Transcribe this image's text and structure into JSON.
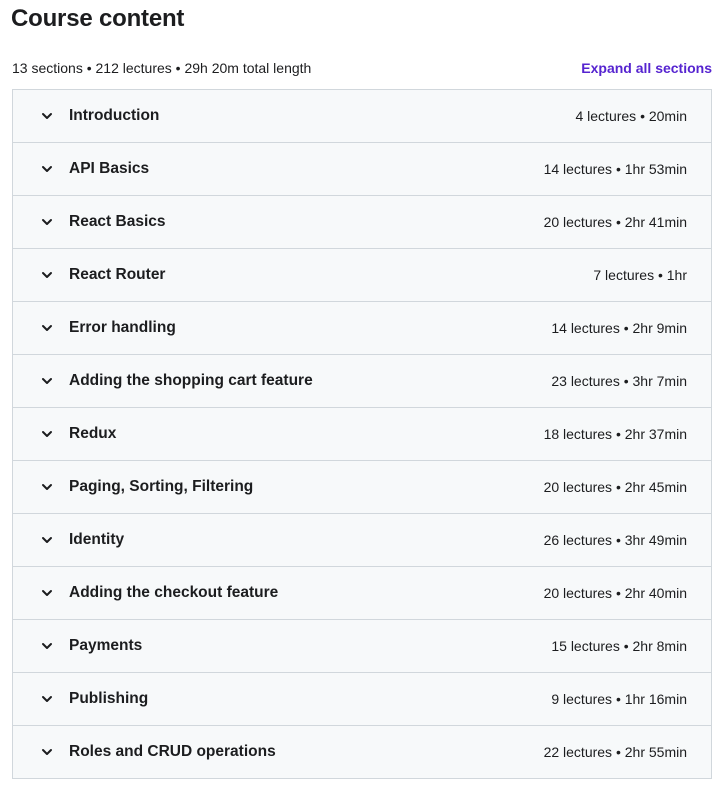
{
  "header": {
    "title": "Course content",
    "summary": "13 sections • 212 lectures • 29h 20m total length",
    "expand_label": "Expand all sections"
  },
  "colors": {
    "accent": "#5624d0",
    "row_background": "#f7f9fa",
    "border": "#d1d7dc",
    "text": "#1c1d1f"
  },
  "icons": {
    "section_toggle": "chevron-down-icon"
  },
  "sections": [
    {
      "title": "Introduction",
      "meta": "4 lectures • 20min"
    },
    {
      "title": "API Basics",
      "meta": "14 lectures • 1hr 53min"
    },
    {
      "title": "React Basics",
      "meta": "20 lectures • 2hr 41min"
    },
    {
      "title": "React Router",
      "meta": "7 lectures • 1hr"
    },
    {
      "title": "Error handling",
      "meta": "14 lectures • 2hr 9min"
    },
    {
      "title": "Adding the shopping cart feature",
      "meta": "23 lectures • 3hr 7min"
    },
    {
      "title": "Redux",
      "meta": "18 lectures • 2hr 37min"
    },
    {
      "title": "Paging, Sorting, Filtering",
      "meta": "20 lectures • 2hr 45min"
    },
    {
      "title": "Identity",
      "meta": "26 lectures • 3hr 49min"
    },
    {
      "title": "Adding the checkout feature",
      "meta": "20 lectures • 2hr 40min"
    },
    {
      "title": "Payments",
      "meta": "15 lectures • 2hr 8min"
    },
    {
      "title": "Publishing",
      "meta": "9 lectures • 1hr 16min"
    },
    {
      "title": "Roles and CRUD operations",
      "meta": "22 lectures • 2hr 55min"
    }
  ]
}
